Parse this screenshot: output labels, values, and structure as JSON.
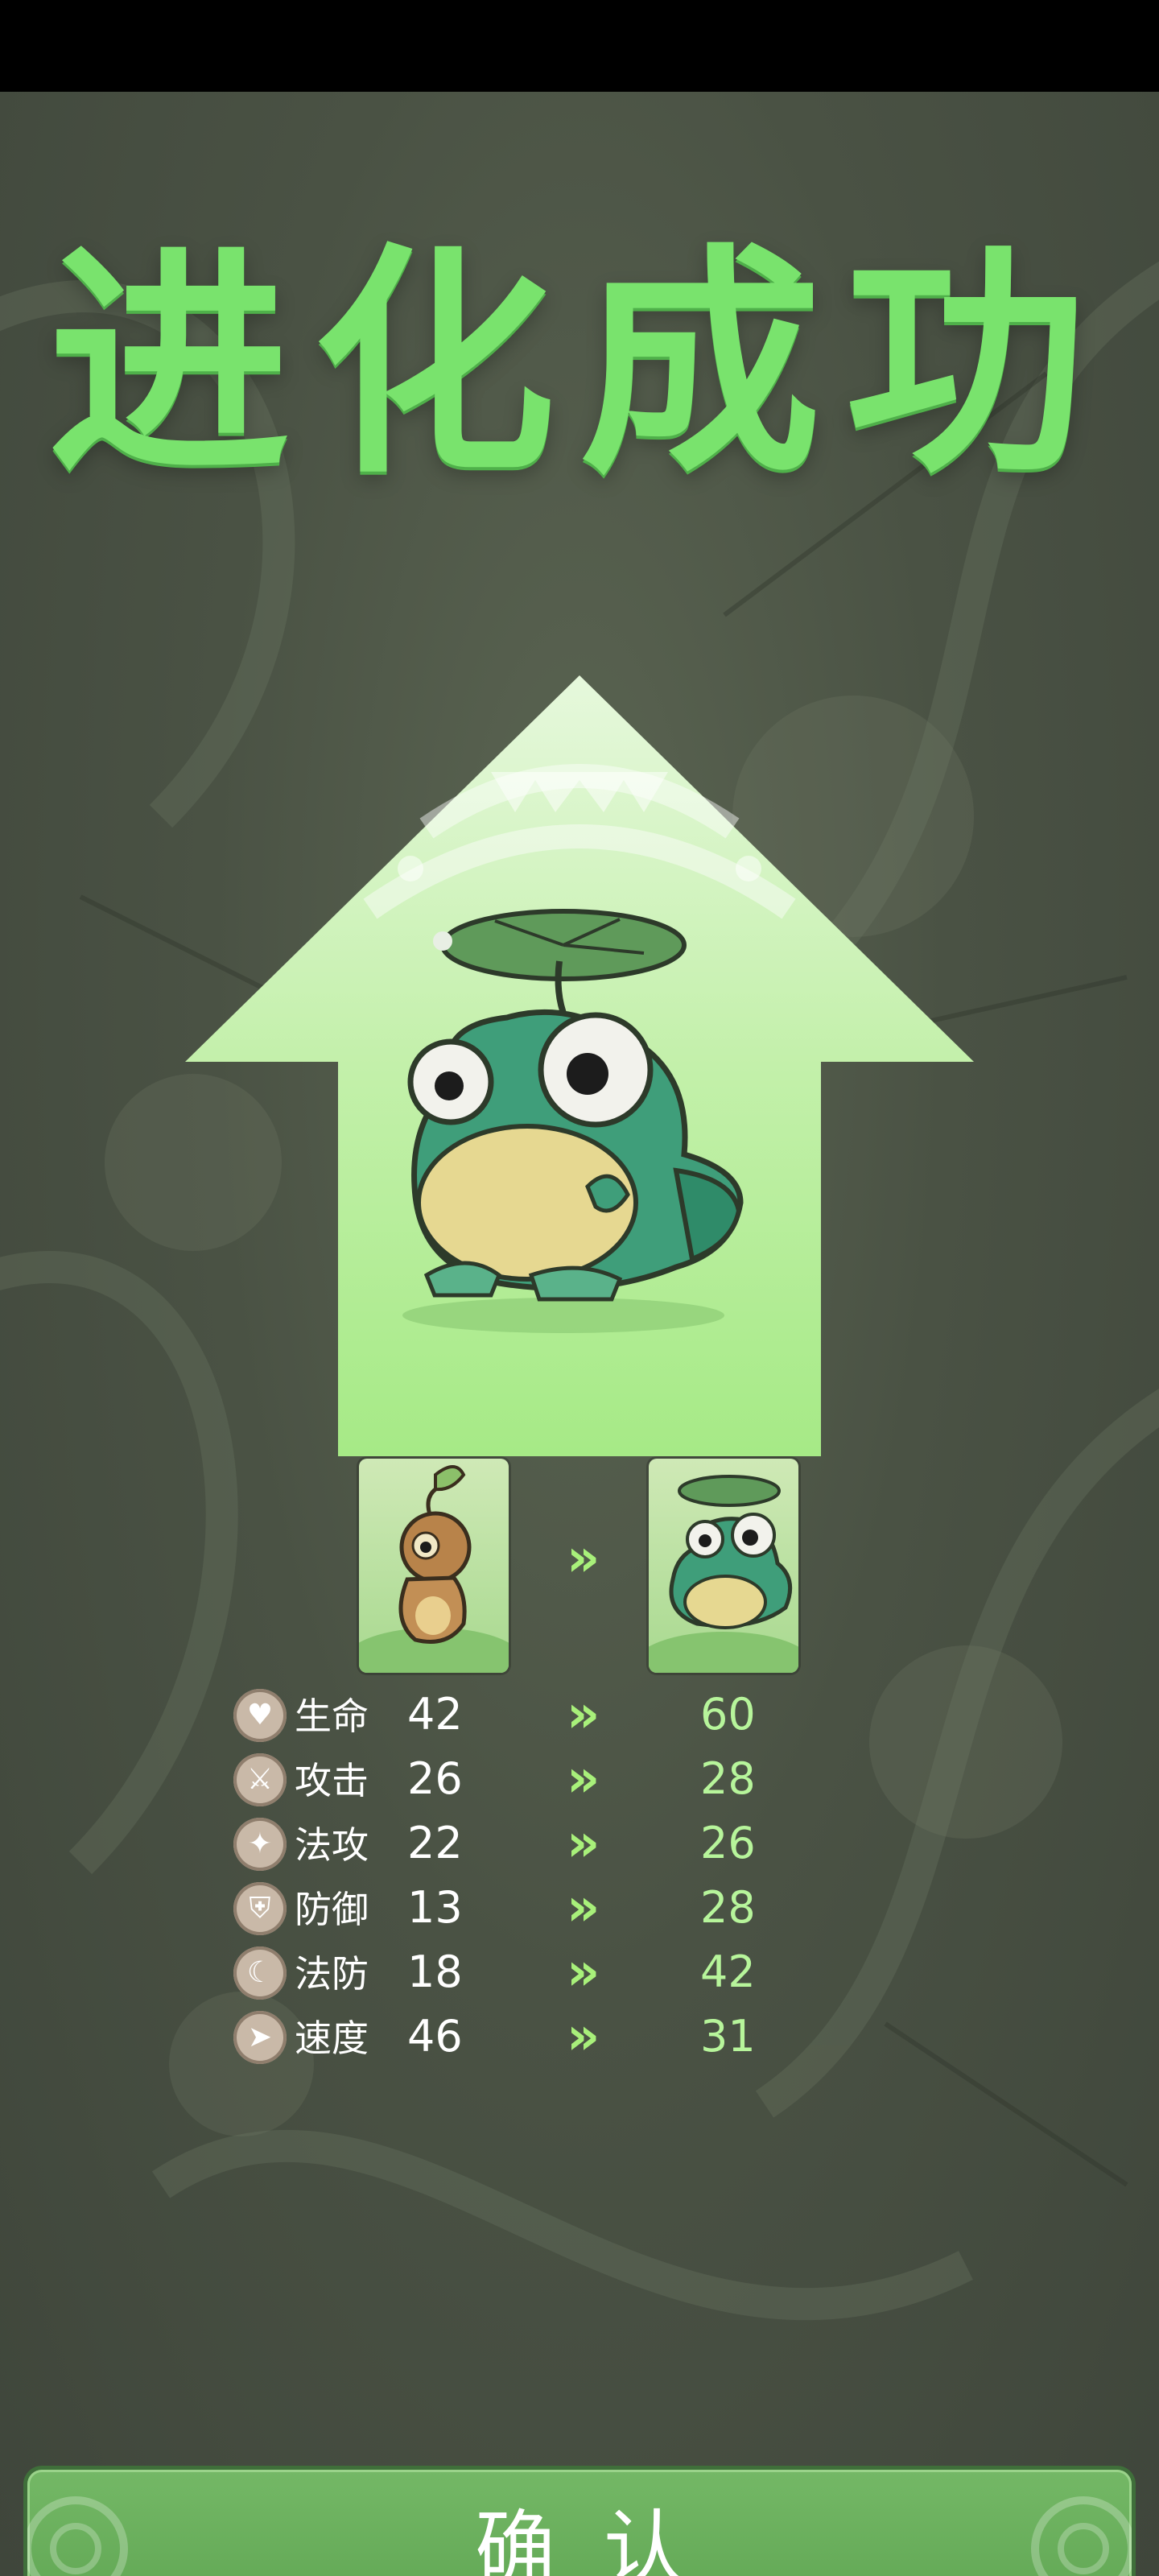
{
  "title": "进化成功",
  "evolution": {
    "before_name_icon": "sprout-creature-icon",
    "after_name_icon": "frog-lilypad-icon",
    "arrow_icon": "double-chevron-right-icon"
  },
  "stats": [
    {
      "icon": "heart-icon",
      "glyph": "♥",
      "label": "生命",
      "old": "42",
      "new": "60"
    },
    {
      "icon": "sword-icon",
      "glyph": "⚔",
      "label": "攻击",
      "old": "26",
      "new": "28"
    },
    {
      "icon": "flame-icon",
      "glyph": "✦",
      "label": "法攻",
      "old": "22",
      "new": "26"
    },
    {
      "icon": "shield-icon",
      "glyph": "⛨",
      "label": "防御",
      "old": "13",
      "new": "28"
    },
    {
      "icon": "swirl-icon",
      "glyph": "☾",
      "label": "法防",
      "old": "18",
      "new": "42"
    },
    {
      "icon": "boot-icon",
      "glyph": "➤",
      "label": "速度",
      "old": "46",
      "new": "31"
    }
  ],
  "chevron": "»",
  "confirm_label": "确认",
  "colors": {
    "title_green": "#79e36d",
    "new_value_green": "#b7f59b",
    "button_green": "#6aaf5c"
  }
}
